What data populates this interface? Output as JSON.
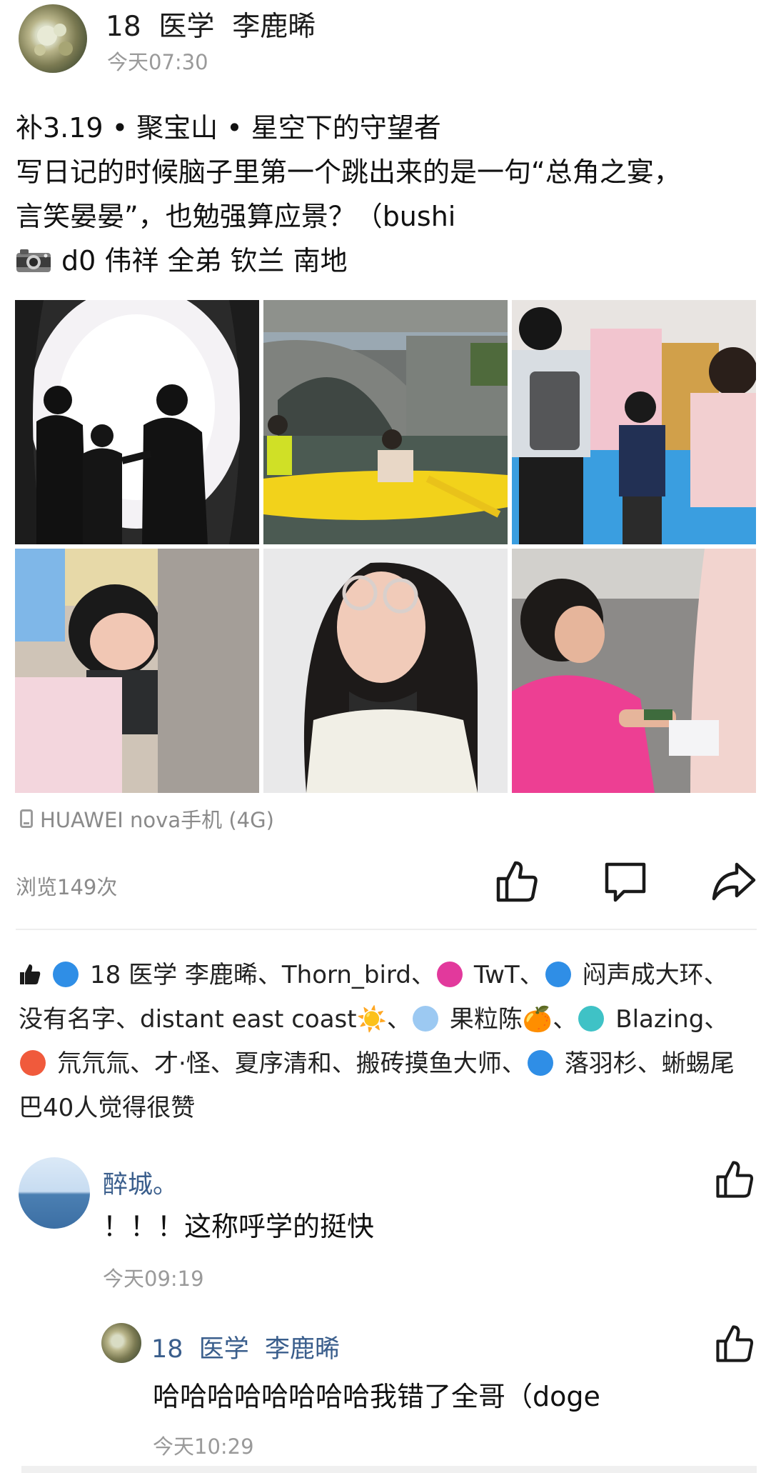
{
  "post": {
    "author": "18  医学  李鹿晞",
    "time": "今天07:30",
    "lines": [
      "补3.19 • 聚宝山 • 星空下的守望者",
      "写日记的时候脑子里第一个跳出来的是一句“总角之宴，",
      "言笑晏晏”，也勉强算应景？（bushi",
      "d0 伟祥 全弟 钦兰 南地"
    ],
    "camera_icon": "camera-icon",
    "device": "HUAWEI nova手机 (4G)",
    "views": "浏览149次"
  },
  "photos": [
    {
      "name": "photo-tunnel-silhouettes"
    },
    {
      "name": "photo-kayak-bridge"
    },
    {
      "name": "photo-children-backpack"
    },
    {
      "name": "photo-child-mask"
    },
    {
      "name": "photo-woman-glasses"
    },
    {
      "name": "photo-girl-pink-jacket"
    }
  ],
  "actions": {
    "like_icon": "thumbs-up-icon",
    "comment_icon": "comment-icon",
    "share_icon": "share-icon"
  },
  "likes": {
    "segments": [
      {
        "type": "icon",
        "name": "radiation-badge-icon",
        "color": "#2f8ee6"
      },
      {
        "type": "text",
        "text": "18  医学  李鹿晞、Thorn_bird、"
      },
      {
        "type": "icon",
        "name": "ball-badge-icon",
        "color": "#e2399c"
      },
      {
        "type": "text",
        "text": "TwT、"
      },
      {
        "type": "icon",
        "name": "radiation-badge-icon",
        "color": "#2f8ee6"
      },
      {
        "type": "text",
        "text": "闷声成大环、没有名字、distant east coast☀️、"
      },
      {
        "type": "icon",
        "name": "pill-badge-icon",
        "color": "#9cc9f2"
      },
      {
        "type": "text",
        "text": "果粒陈🍊、"
      },
      {
        "type": "icon",
        "name": "wing-badge-icon",
        "color": "#3fc2c6"
      },
      {
        "type": "text",
        "text": "Blazing、"
      },
      {
        "type": "icon",
        "name": "star-badge-icon",
        "color": "#f05a3c"
      },
      {
        "type": "text",
        "text": "氘氘氚、才·怪、夏序清和、搬砖摸鱼大师、"
      },
      {
        "type": "icon",
        "name": "radiation-badge-icon",
        "color": "#2f8ee6"
      },
      {
        "type": "text",
        "text": "落羽杉、蜥蜴尾巴40人觉得很赞"
      }
    ]
  },
  "comments": [
    {
      "name": "醉城。",
      "text": "！！！这称呼学的挺快",
      "time": "今天09:19"
    }
  ],
  "reply": {
    "name": "18  医学  李鹿晞",
    "text": "哈哈哈哈哈哈哈哈我错了全哥（doge",
    "time": "今天10:29"
  }
}
